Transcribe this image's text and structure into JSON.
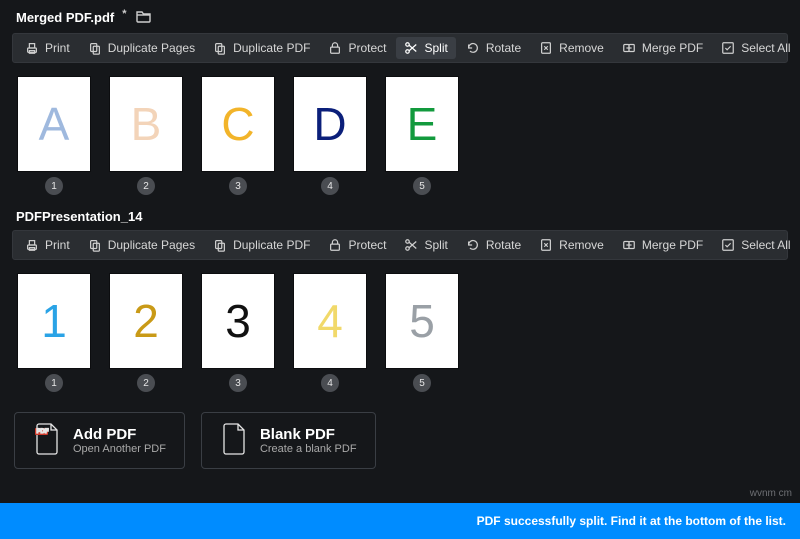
{
  "documents": [
    {
      "title": "Merged PDF.pdf",
      "dirty": true,
      "openable": true,
      "toolbar": [
        {
          "id": "print",
          "label": "Print"
        },
        {
          "id": "dup-pages",
          "label": "Duplicate Pages"
        },
        {
          "id": "dup-pdf",
          "label": "Duplicate PDF"
        },
        {
          "id": "protect",
          "label": "Protect"
        },
        {
          "id": "split",
          "label": "Split",
          "active": true
        },
        {
          "id": "rotate",
          "label": "Rotate"
        },
        {
          "id": "remove",
          "label": "Remove"
        },
        {
          "id": "merge",
          "label": "Merge PDF"
        },
        {
          "id": "select-all",
          "label": "Select All"
        }
      ],
      "pages": [
        {
          "num": "1",
          "glyph": "A",
          "color": "#9fb9de"
        },
        {
          "num": "2",
          "glyph": "B",
          "color": "#f3d4b9"
        },
        {
          "num": "3",
          "glyph": "C",
          "color": "#f2b42a"
        },
        {
          "num": "4",
          "glyph": "D",
          "color": "#0b1f7a"
        },
        {
          "num": "5",
          "glyph": "E",
          "color": "#129a3d"
        }
      ]
    },
    {
      "title": "PDFPresentation_14",
      "dirty": false,
      "openable": false,
      "toolbar": [
        {
          "id": "print",
          "label": "Print"
        },
        {
          "id": "dup-pages",
          "label": "Duplicate Pages"
        },
        {
          "id": "dup-pdf",
          "label": "Duplicate PDF"
        },
        {
          "id": "protect",
          "label": "Protect"
        },
        {
          "id": "split",
          "label": "Split"
        },
        {
          "id": "rotate",
          "label": "Rotate"
        },
        {
          "id": "remove",
          "label": "Remove"
        },
        {
          "id": "merge",
          "label": "Merge PDF"
        },
        {
          "id": "select-all",
          "label": "Select All"
        }
      ],
      "pages": [
        {
          "num": "1",
          "glyph": "1",
          "color": "#2aa3e6"
        },
        {
          "num": "2",
          "glyph": "2",
          "color": "#c99a17"
        },
        {
          "num": "3",
          "glyph": "3",
          "color": "#111111"
        },
        {
          "num": "4",
          "glyph": "4",
          "color": "#f1d96a"
        },
        {
          "num": "5",
          "glyph": "5",
          "color": "#9aa0a6"
        }
      ]
    }
  ],
  "actions": {
    "add_pdf": {
      "title": "Add PDF",
      "subtitle": "Open Another PDF",
      "badge": "PDF"
    },
    "blank_pdf": {
      "title": "Blank PDF",
      "subtitle": "Create a blank PDF"
    }
  },
  "status_message": "PDF successfully split. Find it at the bottom of the list.",
  "watermark": "wvnm cm",
  "icons": {
    "print": "printer",
    "dup-pages": "copy",
    "dup-pdf": "copy",
    "protect": "lock",
    "split": "scissors",
    "rotate": "rotate",
    "remove": "x-file",
    "merge": "merge",
    "select-all": "check"
  }
}
